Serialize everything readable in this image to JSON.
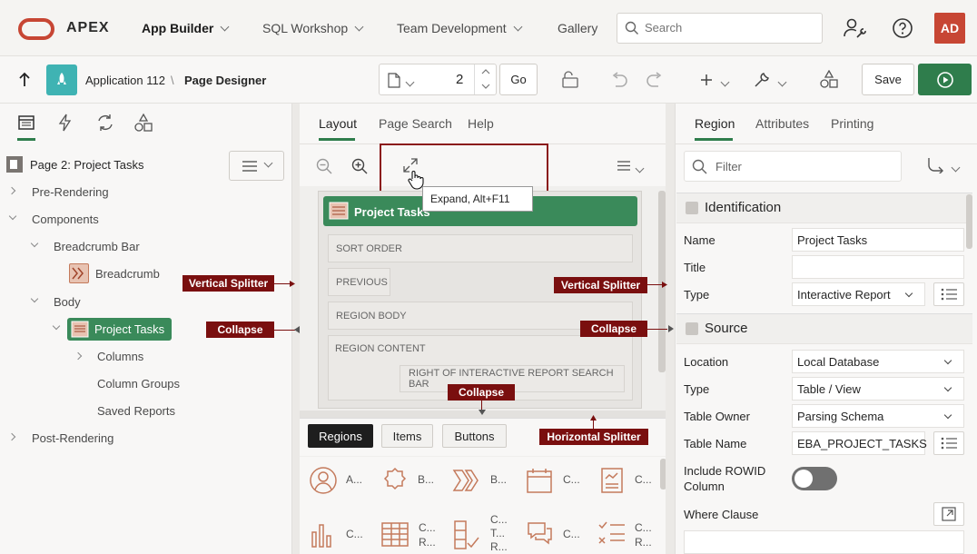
{
  "topbar": {
    "brand": "APEX",
    "nav": [
      "App Builder",
      "SQL Workshop",
      "Team Development",
      "Gallery"
    ],
    "search_placeholder": "Search",
    "avatar": "AD"
  },
  "toolbar": {
    "app_link": "Application 112",
    "separator": "\\",
    "page_title": "Page Designer",
    "page_number": "2",
    "go_label": "Go",
    "save_label": "Save"
  },
  "left": {
    "page_label": "Page 2: Project Tasks",
    "tree": {
      "pre_rendering": "Pre-Rendering",
      "components": "Components",
      "breadcrumb_bar": "Breadcrumb Bar",
      "breadcrumb": "Breadcrumb",
      "body": "Body",
      "project_tasks": "Project Tasks",
      "columns": "Columns",
      "column_groups": "Column Groups",
      "saved_reports": "Saved Reports",
      "post_rendering": "Post-Rendering"
    }
  },
  "middle": {
    "tabs": [
      "Layout",
      "Page Search",
      "Help"
    ],
    "tooltip": "Expand, Alt+F11",
    "region_title": "Project Tasks",
    "slots": {
      "sort_order": "SORT ORDER",
      "previous": "PREVIOUS",
      "region_body": "REGION BODY",
      "region_content": "REGION CONTENT",
      "right_of_search": "RIGHT OF INTERACTIVE REPORT SEARCH BAR"
    },
    "gallery_tabs": [
      "Regions",
      "Items",
      "Buttons"
    ],
    "gallery_row1": [
      "A...",
      "B...",
      "B...",
      "C...",
      "C..."
    ],
    "gallery_row2": [
      "C...",
      "C...\nR...",
      "C...\nT...\nR...",
      "C...",
      "C...\nR..."
    ]
  },
  "right": {
    "tabs": [
      "Region",
      "Attributes",
      "Printing"
    ],
    "filter_placeholder": "Filter",
    "identification": {
      "heading": "Identification",
      "name_label": "Name",
      "name_value": "Project Tasks",
      "title_label": "Title",
      "title_value": "",
      "type_label": "Type",
      "type_value": "Interactive Report"
    },
    "source": {
      "heading": "Source",
      "location_label": "Location",
      "location_value": "Local Database",
      "type_label": "Type",
      "type_value": "Table / View",
      "owner_label": "Table Owner",
      "owner_value": "Parsing Schema",
      "table_label": "Table Name",
      "table_value": "EBA_PROJECT_TASKS",
      "rowid_label_1": "Include ROWID",
      "rowid_label_2": "Column",
      "where_label": "Where Clause"
    }
  },
  "callouts": {
    "vertical_splitter": "Vertical Splitter",
    "collapse": "Collapse",
    "horizontal_splitter": "Horizontal Splitter"
  },
  "colors": {
    "brand": "#c74634",
    "accent_green": "#2f7d4c",
    "callout": "#7a0f0f"
  }
}
